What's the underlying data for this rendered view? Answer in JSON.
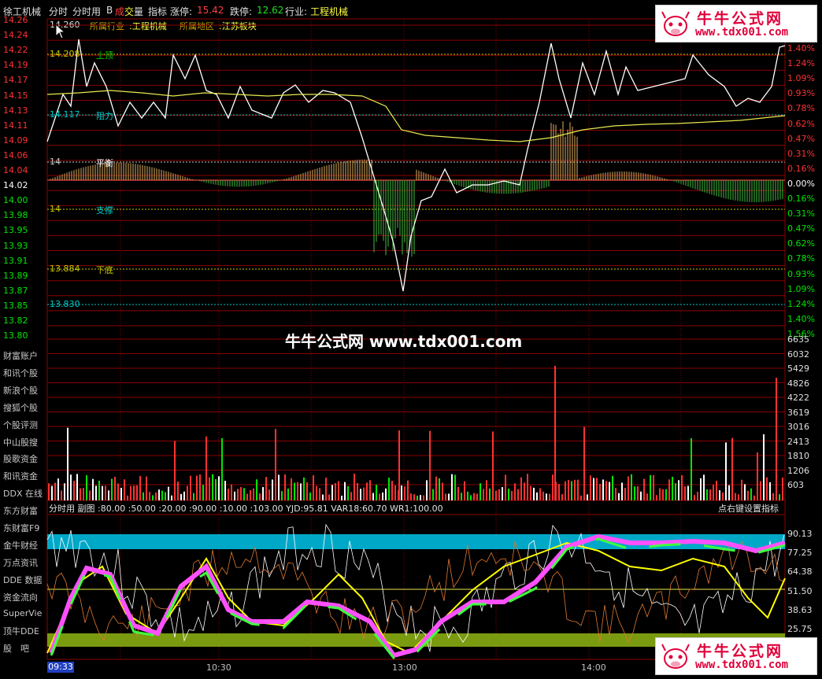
{
  "header": {
    "stock_name": "徐工机械",
    "tab_fenshi": "分时",
    "tab_fenshiyong": "分时用",
    "letter_b": "B",
    "cheng_char": "成",
    "jiao_char": "交",
    "liang_char": "量",
    "indicator": "指标",
    "limit_up_label": "涨停:",
    "limit_up_value": "15.42",
    "limit_down_label": "跌停:",
    "limit_down_value": "12.62",
    "industry_label": "行业:",
    "industry_value": "工程机械"
  },
  "subheader": {
    "top_price": "14.260",
    "sector_label": "所属行业",
    "sector_value": ":工程机械",
    "region_label": "所属地区",
    "region_value": ":江苏板块"
  },
  "levels": [
    {
      "price": "14.208",
      "name": "上顶",
      "color": "#c8c800",
      "name_color": "#00c800"
    },
    {
      "price": "14.117",
      "name": "阻力",
      "color": "#00c8c8",
      "name_color": "#00c8c8"
    },
    {
      "price": "14",
      "name": "平衡",
      "color": "#c8c8c8",
      "name_color": "#ffffff"
    },
    {
      "price": "14",
      "name": "支撑",
      "color": "#c8c800",
      "name_color": "#00c8c8"
    },
    {
      "price": "13.884",
      "name": "下底",
      "color": "#c8c800",
      "name_color": "#c8c800"
    },
    {
      "price": "13.830",
      "name": "",
      "color": "#00c8c8",
      "name_color": "#00c8c8"
    }
  ],
  "price_axis": [
    "14.26",
    "14.24",
    "14.22",
    "14.19",
    "14.17",
    "14.15",
    "14.13",
    "14.11",
    "14.09",
    "14.06",
    "14.04",
    "14.02",
    "14.00",
    "13.98",
    "13.95",
    "13.93",
    "13.91",
    "13.89",
    "13.87",
    "13.85",
    "13.82",
    "13.80"
  ],
  "pct_axis": [
    "1.40%",
    "1.24%",
    "1.09%",
    "0.93%",
    "0.78%",
    "0.62%",
    "0.47%",
    "0.31%",
    "0.16%",
    "0.00%",
    "0.16%",
    "0.31%",
    "0.47%",
    "0.62%",
    "0.78%",
    "0.93%",
    "1.09%",
    "1.24%",
    "1.40%",
    "1.56%"
  ],
  "volume_axis": [
    "6635",
    "6032",
    "5429",
    "4826",
    "4222",
    "3619",
    "3016",
    "2413",
    "1810",
    "1206",
    "603"
  ],
  "watermark": "牛牛公式网 www.tdx001.com",
  "logo": {
    "title": "牛牛公式网",
    "url": "www.tdx001.com"
  },
  "sidebar": [
    "财富账户",
    "和讯个股",
    "新浪个股",
    "搜狐个股",
    "个股评测",
    "中山股搜",
    "股歌资金",
    "和讯资金",
    "DDX 在线",
    "东方财富",
    "东财富F9",
    "金牛财经",
    "万点资讯",
    "DDE 数据",
    "资金流向",
    "SuperVie",
    "顶牛DDE",
    "股　吧"
  ],
  "indicator_bar": {
    "text": "分时用 副图 :80.00 :50.00 :20.00 :90.00 :10.00 :103.00 YJD:95.81 VAR18:60.70 WR1:100.00",
    "right_text": "点右键设置指标"
  },
  "indicator_axis": [
    "90.13",
    "77.25",
    "64.38",
    "51.50",
    "38.63",
    "25.75"
  ],
  "time_axis": {
    "current": "09:33",
    "labels": [
      "10:30",
      "13:00",
      "14:00"
    ]
  },
  "colors": {
    "up": "#ff3232",
    "down": "#00e600",
    "grid": "#8b0000",
    "price_line": "#ffffff",
    "avg_line": "#e8e850",
    "cyan_band": "#00a8c8",
    "olive_band": "#7a9a10"
  }
}
